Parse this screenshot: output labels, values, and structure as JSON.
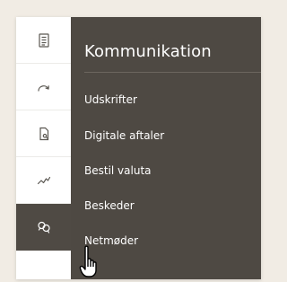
{
  "rail": {
    "items": [
      {
        "icon": "document-icon"
      },
      {
        "icon": "redo-icon"
      },
      {
        "icon": "file-search-icon"
      },
      {
        "icon": "chart-line-icon"
      },
      {
        "icon": "chat-bubbles-icon"
      }
    ]
  },
  "flyout": {
    "title": "Kommunikation",
    "items": [
      {
        "label": "Udskrifter"
      },
      {
        "label": "Digitale aftaler"
      },
      {
        "label": "Bestil valuta"
      },
      {
        "label": "Beskeder"
      },
      {
        "label": "Netmøder"
      }
    ]
  },
  "colors": {
    "page_background": "#f1ece4",
    "rail_background": "#ffffff",
    "flyout_background": "#4e4943",
    "active_item_background": "#4f4a44",
    "icon_stroke": "#5a5751",
    "active_icon_stroke": "#ffffff"
  }
}
